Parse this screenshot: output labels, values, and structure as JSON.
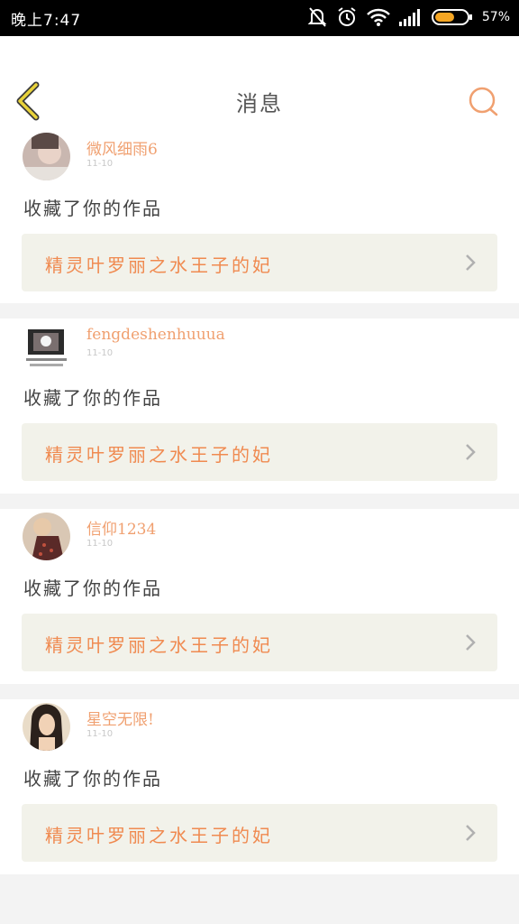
{
  "status": {
    "time": "晚上7:47",
    "battery": "57%",
    "icons": [
      "mute-bell-icon",
      "alarm-icon",
      "wifi-icon",
      "signal-icon",
      "battery-icon"
    ]
  },
  "header": {
    "title": "消息",
    "back_icon": "chevron-left-icon",
    "search_icon": "search-icon"
  },
  "colors": {
    "accent": "#f0a070",
    "back_yellow": "#e8d23a",
    "work_bg": "#f2f2ea"
  },
  "messages": [
    {
      "user": "微风细雨6",
      "time": "11-10",
      "action": "收藏了你的作品",
      "work": "精灵叶罗丽之水王子的妃"
    },
    {
      "user": "fengdeshenhuuua",
      "time": "11-10",
      "action": "收藏了你的作品",
      "work": "精灵叶罗丽之水王子的妃"
    },
    {
      "user": "信仰1234",
      "time": "11-10",
      "action": "收藏了你的作品",
      "work": "精灵叶罗丽之水王子的妃"
    },
    {
      "user": "星空无限!",
      "time": "11-10",
      "action": "收藏了你的作品",
      "work": "精灵叶罗丽之水王子的妃"
    }
  ]
}
